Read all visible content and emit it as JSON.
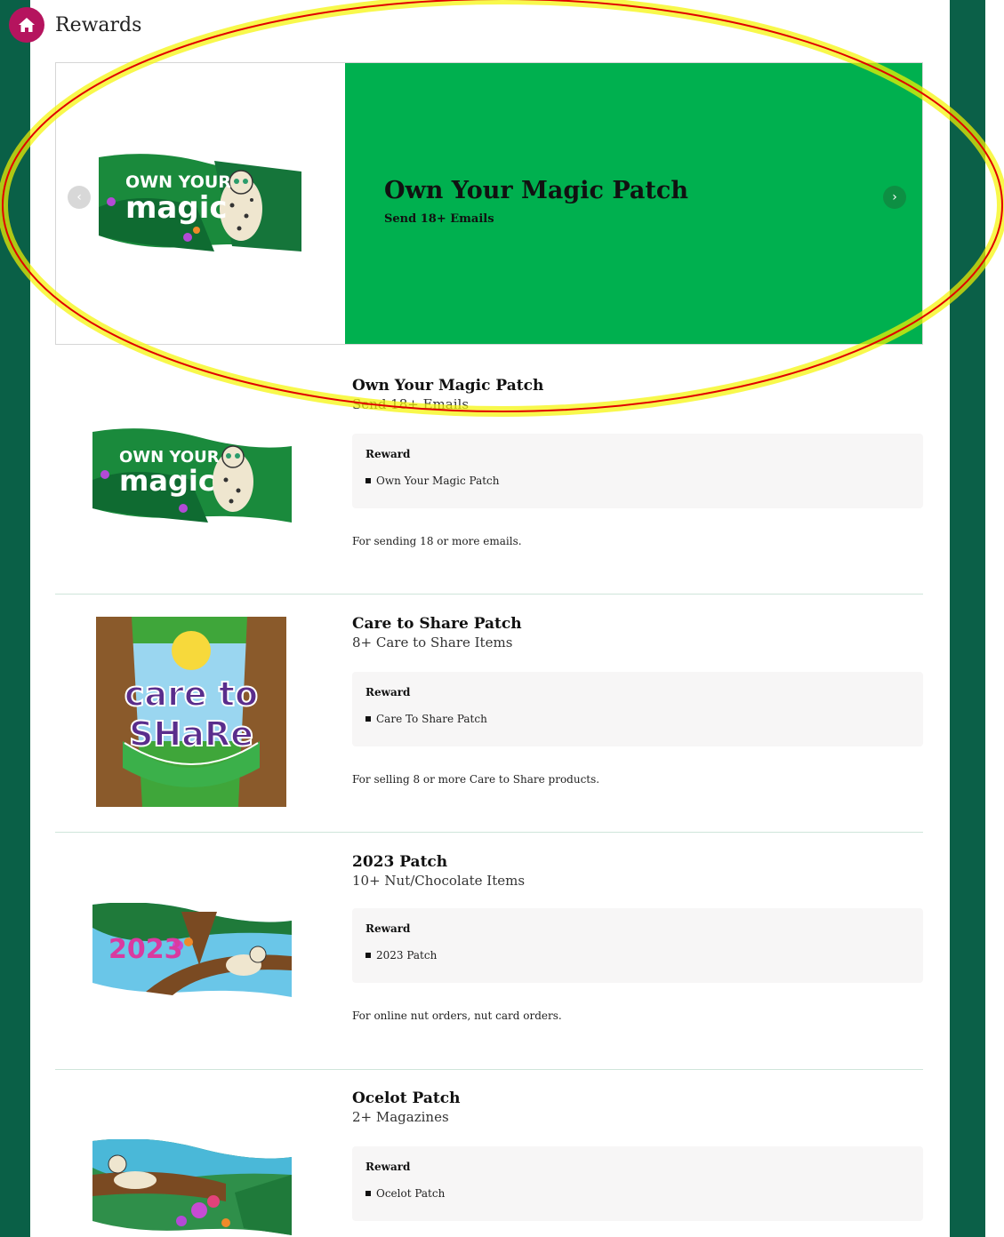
{
  "header": {
    "title": "Rewards",
    "icon": "home-icon"
  },
  "carousel": {
    "title": "Own Your Magic Patch",
    "subtitle": "Send 18+ Emails",
    "patch_line1": "OWN YOUR",
    "patch_line2": "magic",
    "prev_icon": "chevron-left-icon",
    "next_icon": "chevron-right-icon"
  },
  "colors": {
    "accent_green": "#00b04f",
    "home_badge": "#b5145e",
    "highlight_ring": "#e00000",
    "highlight_glow": "#f5f500"
  },
  "reward_label": "Reward",
  "rewards": [
    {
      "title": "Own Your Magic Patch",
      "subtitle": "Send 18+ Emails",
      "item": "Own Your Magic Patch",
      "description": "For sending 18 or more emails.",
      "patch_line1": "OWN YOUR",
      "patch_line2": "magic"
    },
    {
      "title": "Care to Share Patch",
      "subtitle": "8+ Care to Share Items",
      "item": "Care To Share Patch",
      "description": "For selling 8 or more Care to Share products.",
      "patch_line1": "care to",
      "patch_line2": "SHaRe"
    },
    {
      "title": "2023 Patch",
      "subtitle": "10+ Nut/Chocolate Items",
      "item": "2023 Patch",
      "description": "For online nut orders, nut card orders.",
      "patch_line1": "2023"
    },
    {
      "title": "Ocelot Patch",
      "subtitle": "2+ Magazines",
      "item": "Ocelot Patch"
    }
  ]
}
